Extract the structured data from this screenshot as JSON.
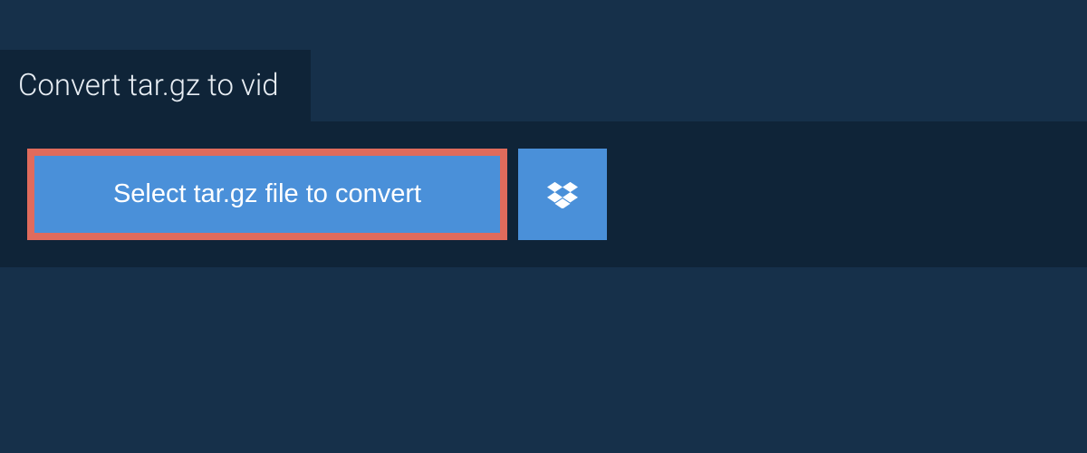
{
  "tab": {
    "title": "Convert tar.gz to vid"
  },
  "actions": {
    "select_file_label": "Select tar.gz file to convert"
  }
}
